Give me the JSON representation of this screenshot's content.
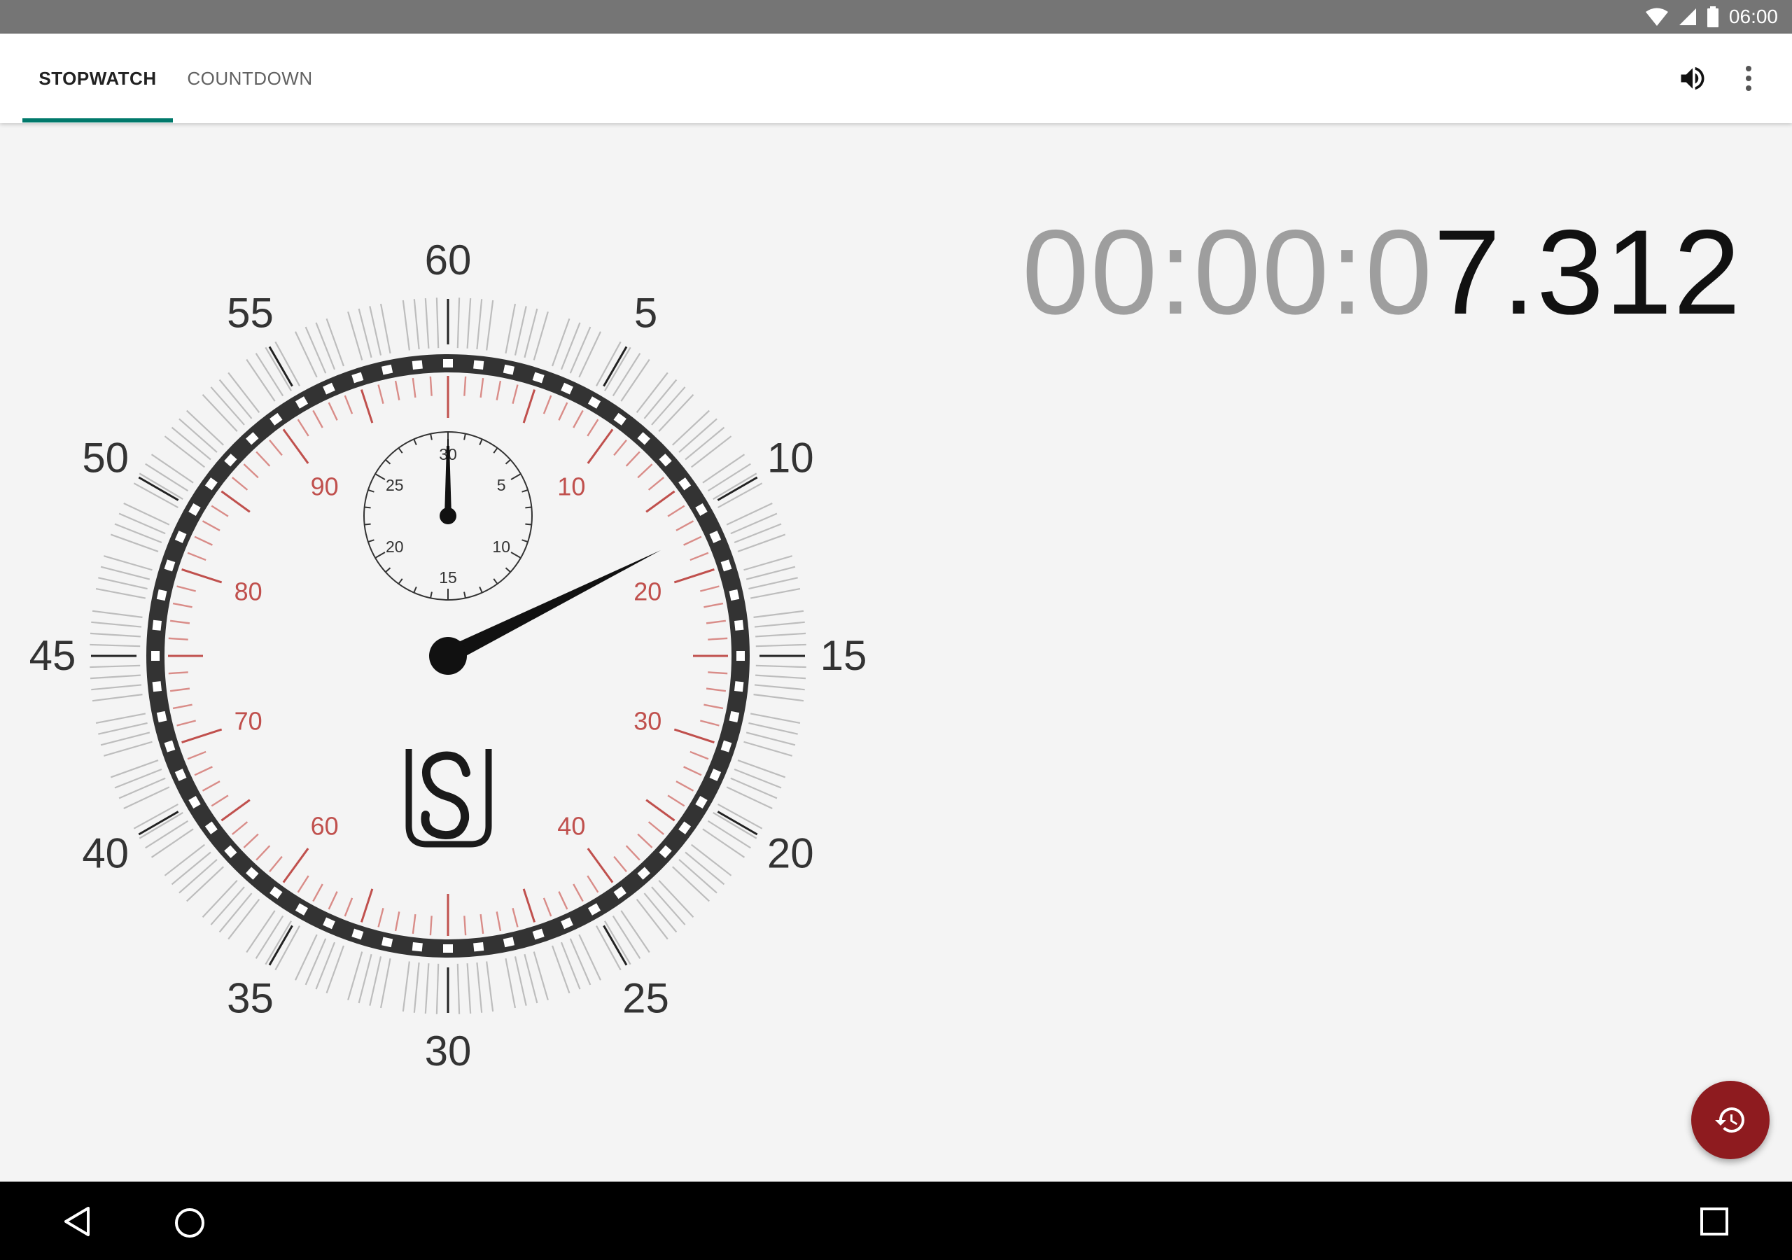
{
  "status_bar": {
    "time": "06:00",
    "icons": [
      "wifi-icon",
      "cell-signal-icon",
      "battery-icon"
    ]
  },
  "tabs": [
    {
      "label": "STOPWATCH",
      "active": true
    },
    {
      "label": "COUNTDOWN",
      "active": false
    }
  ],
  "toolbar": {
    "icons": [
      "volume-icon",
      "more-vert-icon"
    ]
  },
  "dial": {
    "outer_labels": [
      "60",
      "5",
      "10",
      "15",
      "20",
      "25",
      "30",
      "35",
      "40",
      "45",
      "50",
      "55"
    ],
    "inner_labels": [
      "10",
      "20",
      "30",
      "40",
      "60",
      "70",
      "80",
      "90"
    ],
    "sub_dial_labels": [
      "30",
      "5",
      "10",
      "15",
      "20",
      "25"
    ],
    "logo_icon": "su-logo-icon",
    "inner_color": "#c0504d",
    "ring_color": "#333333",
    "needle_color": "#111111"
  },
  "time": {
    "muted": "00:00:0",
    "strong": "7.312"
  },
  "fab": {
    "icon": "history-icon",
    "color": "#8e1b1f"
  },
  "nav": {
    "icons": [
      "back-icon",
      "home-icon",
      "recents-icon"
    ]
  },
  "accent_color": "#00796b"
}
